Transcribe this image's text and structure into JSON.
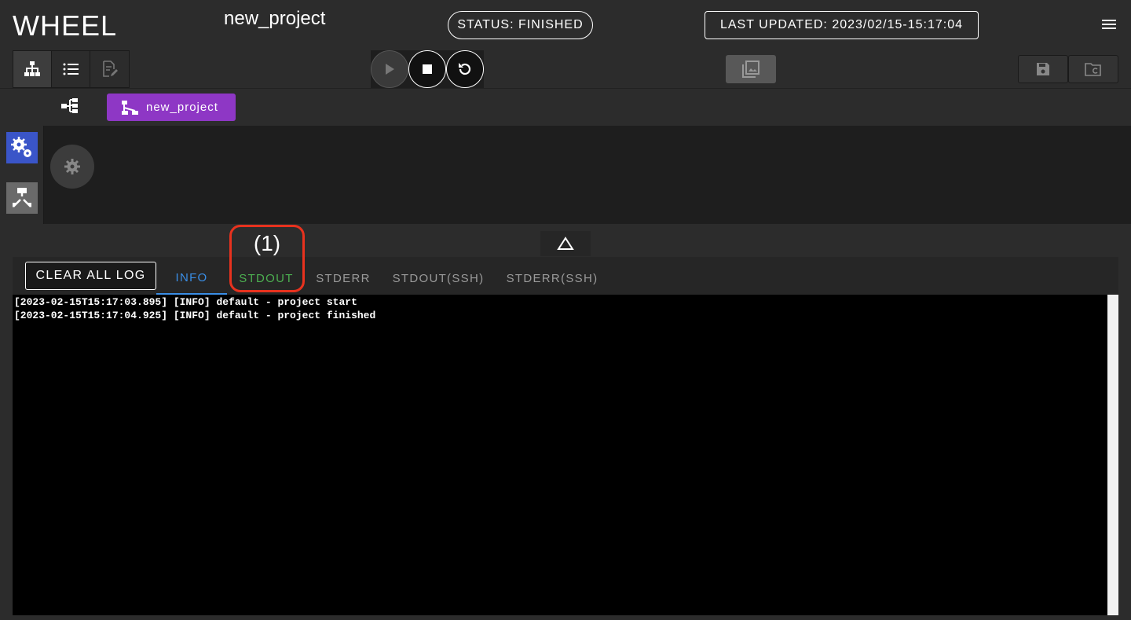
{
  "header": {
    "app_title": "WHEEL",
    "project_name": "new_project",
    "status": "STATUS: FINISHED",
    "last_updated": "LAST UPDATED: 2023/02/15-15:17:04"
  },
  "icons": {
    "menu": "hamburger-menu-icon",
    "workflow_view": "workflow-tree-icon",
    "list_view": "list-icon",
    "edit_view": "edit-document-icon",
    "run": "play-icon",
    "stop": "stop-icon",
    "reload": "reload-icon",
    "graph": "image-gallery-icon",
    "save": "save-icon",
    "revert": "folder-revert-icon",
    "tree": "component-tree-icon",
    "breadcrumb": "workflow-icon",
    "component": "gears-icon",
    "ssh": "ssh-transfer-icon",
    "settings": "gear-icon",
    "collapse": "triangle-up-icon"
  },
  "breadcrumb": {
    "label": "new_project",
    "color": "#8e37c5"
  },
  "colors": {
    "accent_info": "#3a8ee6",
    "accent_stdout": "#4caf50",
    "annotation": "#e8321e"
  },
  "log": {
    "clear_label": "CLEAR ALL LOG",
    "tabs": [
      {
        "label": "INFO",
        "active": true
      },
      {
        "label": "STDOUT",
        "active": false
      },
      {
        "label": "STDERR",
        "active": false
      },
      {
        "label": "STDOUT(SSH)",
        "active": false
      },
      {
        "label": "STDERR(SSH)",
        "active": false
      }
    ],
    "lines": [
      "[2023-02-15T15:17:03.895] [INFO] default - project start",
      "[2023-02-15T15:17:04.925] [INFO] default - project finished"
    ]
  },
  "annotation": {
    "label": "(1)"
  }
}
